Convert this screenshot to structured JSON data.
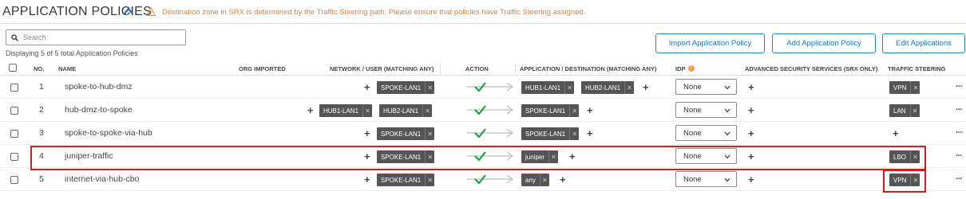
{
  "header": {
    "title": "APPLICATION POLICIES",
    "warning": "Destination zone in SRX is determined by the Traffic Steering path. Please ensure that policies have Traffic Steering assigned."
  },
  "toolbar": {
    "search_placeholder": "Search",
    "count_text": "Displaying 5 of 5 total Application Policies",
    "import_label": "Import Application Policy",
    "add_label": "Add Application Policy",
    "edit_label": "Edit Applications"
  },
  "columns": {
    "no": "NO.",
    "name": "NAME",
    "org_imported": "ORG IMPORTED",
    "network": "NETWORK / USER (MATCHING ANY)",
    "action": "ACTION",
    "application": "APPLICATION / DESTINATION (MATCHING ANY)",
    "idp": "IDP",
    "advanced": "ADVANCED SECURITY SERVICES (SRX ONLY)",
    "steering": "TRAFFIC STEERING"
  },
  "colors": {
    "accent": "#1f89bf",
    "warning": "#e0823a",
    "allow": "#1aa33f",
    "tag": "#555555",
    "highlight": "#d51d1d"
  },
  "rows": [
    {
      "no": "1",
      "name": "spoke-to-hub-dmz",
      "network": [
        "SPOKE-LAN1"
      ],
      "application": [
        "HUB1-LAN1",
        "HUB2-LAN1"
      ],
      "idp": "None",
      "steering": "VPN",
      "action": "allow"
    },
    {
      "no": "2",
      "name": "hub-dmz-to-spoke",
      "network": [
        "HUB1-LAN1",
        "HUB2-LAN1"
      ],
      "application": [
        "SPOKE-LAN1"
      ],
      "idp": "None",
      "steering": "LAN",
      "action": "allow"
    },
    {
      "no": "3",
      "name": "spoke-to-spoke-via-hub",
      "network": [
        "SPOKE-LAN1"
      ],
      "application": [
        "SPOKE-LAN1"
      ],
      "idp": "None",
      "steering": "",
      "action": "allow"
    },
    {
      "no": "4",
      "name": "juniper-traffic",
      "network": [
        "SPOKE-LAN1"
      ],
      "application": [
        "juniper"
      ],
      "idp": "None",
      "steering": "LBO",
      "action": "allow"
    },
    {
      "no": "5",
      "name": "internet-via-hub-cbo",
      "network": [
        "SPOKE-LAN1"
      ],
      "application": [
        "any"
      ],
      "idp": "None",
      "steering": "VPN",
      "action": "allow"
    }
  ]
}
